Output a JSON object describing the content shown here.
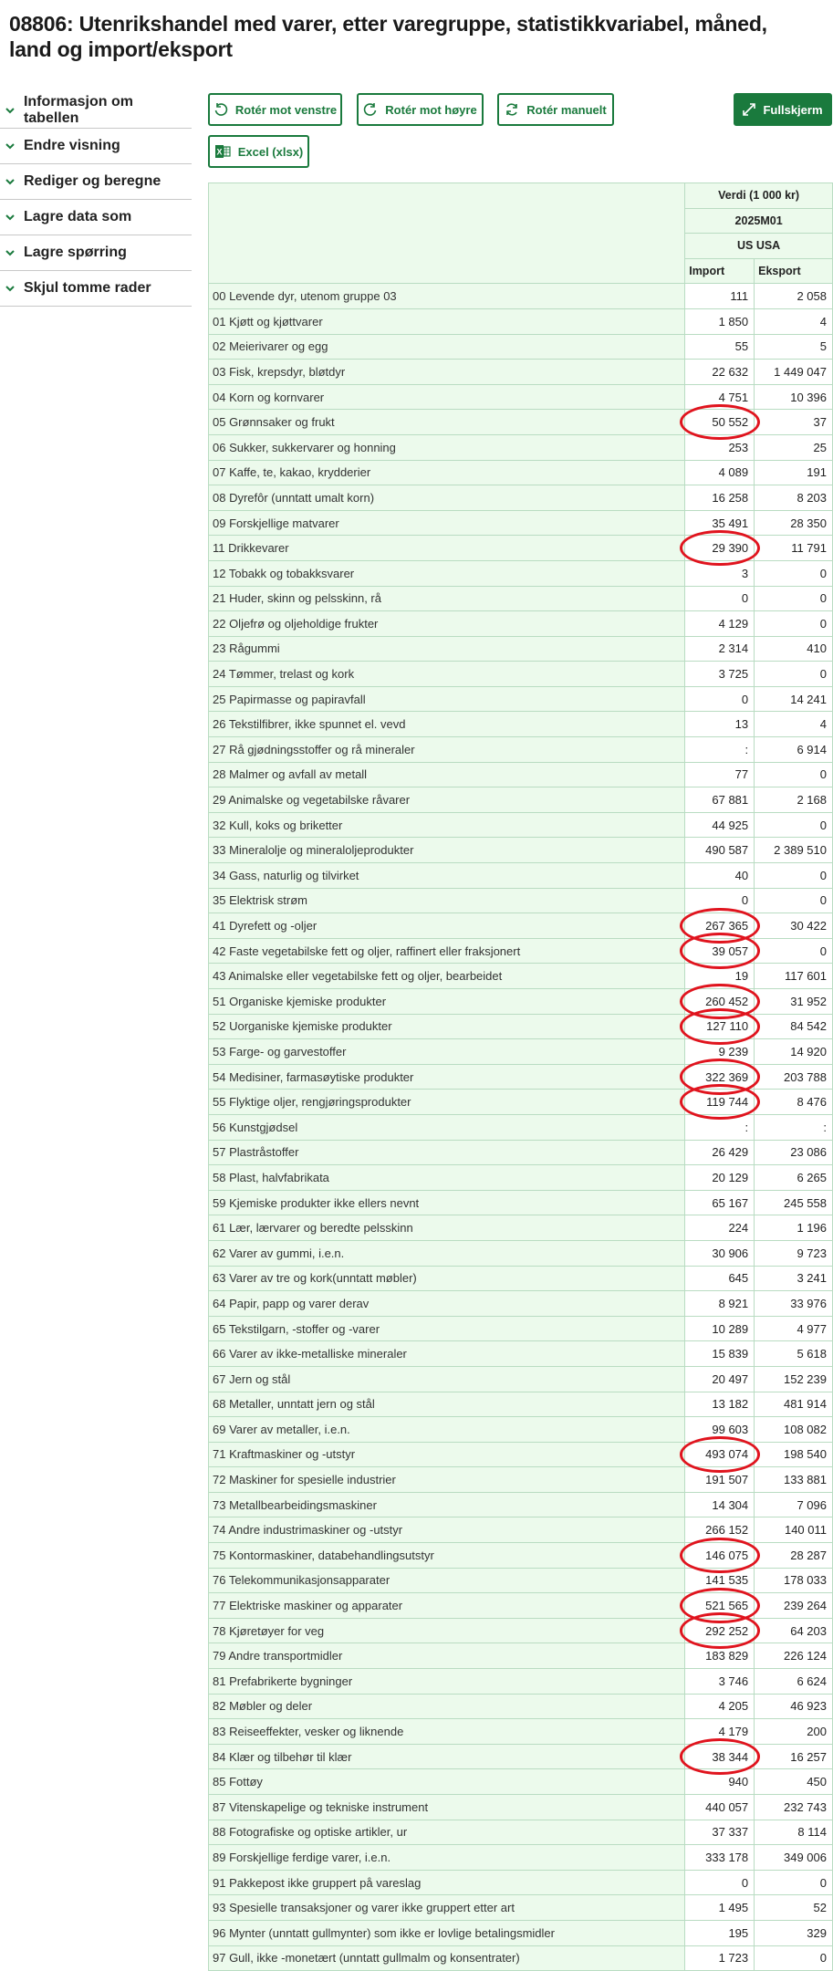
{
  "title": "08806: Utenrikshandel med varer, etter varegruppe, statistikkvariabel, måned, land og import/eksport",
  "sidebar": [
    {
      "label": "Informasjon om tabellen"
    },
    {
      "label": "Endre visning"
    },
    {
      "label": "Rediger og beregne"
    },
    {
      "label": "Lagre data som"
    },
    {
      "label": "Lagre spørring"
    },
    {
      "label": "Skjul tomme rader"
    }
  ],
  "toolbar": {
    "rotate_left": "Rotér mot venstre",
    "rotate_right": "Rotér mot høyre",
    "rotate_manual": "Rotér manuelt",
    "fullscreen": "Fullskjerm",
    "excel": "Excel (xlsx)"
  },
  "table": {
    "header_var": "Verdi (1 000 kr)",
    "header_month": "2025M01",
    "header_country": "US USA",
    "col_import": "Import",
    "col_export": "Eksport",
    "rows": [
      {
        "label": "00 Levende dyr, utenom gruppe 03",
        "imp": "111",
        "exp": "2 058"
      },
      {
        "label": "01 Kjøtt og kjøttvarer",
        "imp": "1 850",
        "exp": "4"
      },
      {
        "label": "02 Meierivarer og egg",
        "imp": "55",
        "exp": "5"
      },
      {
        "label": "03 Fisk, krepsdyr, bløtdyr",
        "imp": "22 632",
        "exp": "1 449 047"
      },
      {
        "label": "04 Korn og kornvarer",
        "imp": "4 751",
        "exp": "10 396"
      },
      {
        "label": "05 Grønnsaker og frukt",
        "imp": "50 552",
        "exp": "37",
        "circled": true
      },
      {
        "label": "06 Sukker, sukkervarer og honning",
        "imp": "253",
        "exp": "25"
      },
      {
        "label": "07 Kaffe, te, kakao, krydderier",
        "imp": "4 089",
        "exp": "191"
      },
      {
        "label": "08 Dyrefôr (unntatt umalt korn)",
        "imp": "16 258",
        "exp": "8 203"
      },
      {
        "label": "09 Forskjellige matvarer",
        "imp": "35 491",
        "exp": "28 350"
      },
      {
        "label": "11 Drikkevarer",
        "imp": "29 390",
        "exp": "11 791",
        "circled": true
      },
      {
        "label": "12 Tobakk og tobakksvarer",
        "imp": "3",
        "exp": "0"
      },
      {
        "label": "21 Huder, skinn og pelsskinn, rå",
        "imp": "0",
        "exp": "0"
      },
      {
        "label": "22 Oljefrø og oljeholdige frukter",
        "imp": "4 129",
        "exp": "0"
      },
      {
        "label": "23 Rågummi",
        "imp": "2 314",
        "exp": "410"
      },
      {
        "label": "24 Tømmer, trelast og kork",
        "imp": "3 725",
        "exp": "0"
      },
      {
        "label": "25 Papirmasse og papiravfall",
        "imp": "0",
        "exp": "14 241"
      },
      {
        "label": "26 Tekstilfibrer, ikke spunnet el. vevd",
        "imp": "13",
        "exp": "4"
      },
      {
        "label": "27 Rå gjødningsstoffer og rå mineraler",
        "imp": ":",
        "exp": "6 914"
      },
      {
        "label": "28 Malmer og avfall av metall",
        "imp": "77",
        "exp": "0"
      },
      {
        "label": "29 Animalske og vegetabilske råvarer",
        "imp": "67 881",
        "exp": "2 168"
      },
      {
        "label": "32 Kull, koks og briketter",
        "imp": "44 925",
        "exp": "0"
      },
      {
        "label": "33 Mineralolje og mineraloljeprodukter",
        "imp": "490 587",
        "exp": "2 389 510"
      },
      {
        "label": "34 Gass, naturlig og tilvirket",
        "imp": "40",
        "exp": "0"
      },
      {
        "label": "35 Elektrisk strøm",
        "imp": "0",
        "exp": "0"
      },
      {
        "label": "41 Dyrefett og -oljer",
        "imp": "267 365",
        "exp": "30 422",
        "circled": true
      },
      {
        "label": "42 Faste vegetabilske fett og oljer, raffinert eller fraksjonert",
        "imp": "39 057",
        "exp": "0",
        "circled": true
      },
      {
        "label": "43 Animalske eller vegetabilske fett og oljer, bearbeidet",
        "imp": "19",
        "exp": "117 601"
      },
      {
        "label": "51 Organiske kjemiske produkter",
        "imp": "260 452",
        "exp": "31 952",
        "circled": true
      },
      {
        "label": "52 Uorganiske kjemiske produkter",
        "imp": "127 110",
        "exp": "84 542",
        "circled": true
      },
      {
        "label": "53 Farge- og garvestoffer",
        "imp": "9 239",
        "exp": "14 920"
      },
      {
        "label": "54 Medisiner, farmasøytiske produkter",
        "imp": "322 369",
        "exp": "203 788",
        "circled": true
      },
      {
        "label": "55 Flyktige oljer, rengjøringsprodukter",
        "imp": "119 744",
        "exp": "8 476",
        "circled": true
      },
      {
        "label": "56 Kunstgjødsel",
        "imp": ":",
        "exp": ":"
      },
      {
        "label": "57 Plastråstoffer",
        "imp": "26 429",
        "exp": "23 086"
      },
      {
        "label": "58 Plast, halvfabrikata",
        "imp": "20 129",
        "exp": "6 265"
      },
      {
        "label": "59 Kjemiske produkter ikke ellers nevnt",
        "imp": "65 167",
        "exp": "245 558"
      },
      {
        "label": "61 Lær, lærvarer og beredte pelsskinn",
        "imp": "224",
        "exp": "1 196"
      },
      {
        "label": "62 Varer av gummi, i.e.n.",
        "imp": "30 906",
        "exp": "9 723"
      },
      {
        "label": "63 Varer av tre og kork(unntatt møbler)",
        "imp": "645",
        "exp": "3 241"
      },
      {
        "label": "64 Papir, papp og varer derav",
        "imp": "8 921",
        "exp": "33 976"
      },
      {
        "label": "65 Tekstilgarn, -stoffer og -varer",
        "imp": "10 289",
        "exp": "4 977"
      },
      {
        "label": "66 Varer av ikke-metalliske mineraler",
        "imp": "15 839",
        "exp": "5 618"
      },
      {
        "label": "67 Jern og stål",
        "imp": "20 497",
        "exp": "152 239"
      },
      {
        "label": "68 Metaller, unntatt jern og stål",
        "imp": "13 182",
        "exp": "481 914"
      },
      {
        "label": "69 Varer av metaller, i.e.n.",
        "imp": "99 603",
        "exp": "108 082"
      },
      {
        "label": "71 Kraftmaskiner og -utstyr",
        "imp": "493 074",
        "exp": "198 540",
        "circled": true
      },
      {
        "label": "72 Maskiner for spesielle industrier",
        "imp": "191 507",
        "exp": "133 881"
      },
      {
        "label": "73 Metallbearbeidingsmaskiner",
        "imp": "14 304",
        "exp": "7 096"
      },
      {
        "label": "74 Andre industrimaskiner og -utstyr",
        "imp": "266 152",
        "exp": "140 011"
      },
      {
        "label": "75 Kontormaskiner, databehandlingsutstyr",
        "imp": "146 075",
        "exp": "28 287",
        "circled": true
      },
      {
        "label": "76 Telekommunikasjonsapparater",
        "imp": "141 535",
        "exp": "178 033"
      },
      {
        "label": "77 Elektriske maskiner og apparater",
        "imp": "521 565",
        "exp": "239 264",
        "circled": true
      },
      {
        "label": "78 Kjøretøyer for veg",
        "imp": "292 252",
        "exp": "64 203",
        "circled": true
      },
      {
        "label": "79 Andre transportmidler",
        "imp": "183 829",
        "exp": "226 124"
      },
      {
        "label": "81 Prefabrikerte bygninger",
        "imp": "3 746",
        "exp": "6 624"
      },
      {
        "label": "82 Møbler og deler",
        "imp": "4 205",
        "exp": "46 923"
      },
      {
        "label": "83 Reiseeffekter, vesker og liknende",
        "imp": "4 179",
        "exp": "200"
      },
      {
        "label": "84 Klær og tilbehør til klær",
        "imp": "38 344",
        "exp": "16 257",
        "circled": true
      },
      {
        "label": "85 Fottøy",
        "imp": "940",
        "exp": "450"
      },
      {
        "label": "87 Vitenskapelige og tekniske instrument",
        "imp": "440 057",
        "exp": "232 743"
      },
      {
        "label": "88 Fotografiske og optiske artikler, ur",
        "imp": "37 337",
        "exp": "8 114"
      },
      {
        "label": "89 Forskjellige ferdige varer, i.e.n.",
        "imp": "333 178",
        "exp": "349 006"
      },
      {
        "label": "91 Pakkepost ikke gruppert på vareslag",
        "imp": "0",
        "exp": "0"
      },
      {
        "label": "93 Spesielle transaksjoner og varer ikke gruppert etter art",
        "imp": "1 495",
        "exp": "52"
      },
      {
        "label": "96 Mynter (unntatt gullmynter) som ikke er lovlige betalingsmidler",
        "imp": "195",
        "exp": "329"
      },
      {
        "label": "97 Gull, ikke -monetært (unntatt gullmalm og konsentrater)",
        "imp": "1 723",
        "exp": "0"
      }
    ]
  },
  "colors": {
    "accent": "#1a7a3d",
    "header_bg": "#ecfaec",
    "annotation": "#e0141e"
  }
}
